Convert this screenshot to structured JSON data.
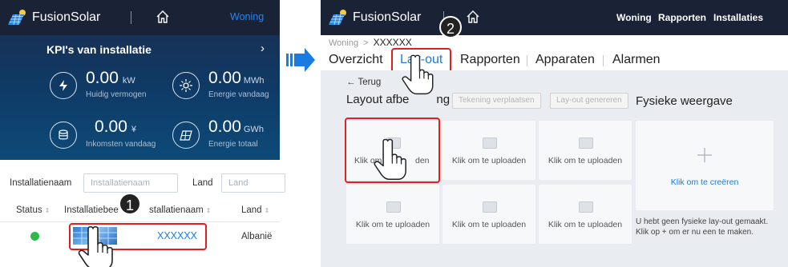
{
  "colors": {
    "accent": "#1a7be0",
    "highlight": "#e02020",
    "online": "#2fb84a"
  },
  "left": {
    "app_title": "FusionSolar",
    "nav_active": "Woning",
    "kpi_title": "KPI's van installatie",
    "kpis": [
      {
        "value": "0.00",
        "unit": "kW",
        "label": "Huidig vermogen"
      },
      {
        "value": "0.00",
        "unit": "MWh",
        "label": "Energie vandaag"
      },
      {
        "value": "0.00",
        "unit": "¥",
        "label": "Inkomsten vandaag"
      },
      {
        "value": "0.00",
        "unit": "GWh",
        "label": "Energie totaal"
      }
    ],
    "filter": {
      "name_label": "Installatienaam",
      "name_placeholder": "Installatienaam",
      "country_label": "Land",
      "country_placeholder": "Land"
    },
    "table": {
      "headers": [
        "Status",
        "Installatiebee",
        "stallatienaam",
        "Land"
      ],
      "row": {
        "name": "XXXXXX",
        "country": "Albanië"
      }
    },
    "step_badge": "1"
  },
  "right": {
    "app_title": "FusionSolar",
    "nav": [
      "Woning",
      "Rapporten",
      "Installaties"
    ],
    "breadcrumb": {
      "root": "Woning",
      "sep": ">",
      "current": "XXXXXX"
    },
    "tabs": [
      "Overzicht",
      "Lay-out",
      "Rapporten",
      "Apparaten",
      "Alarmen"
    ],
    "active_tab": "Lay-out",
    "back": "Terug",
    "section_title": "Layout afbe",
    "section_title_tail": "ng",
    "btn_move": "Tekening verplaatsen",
    "btn_generate": "Lay-out genereren",
    "physical_title": "Fysieke weergave",
    "tile_label": "Klik om te uploaden",
    "tile_label_partial_left": "Klik om te",
    "tile_label_partial_right": "den",
    "create_label": "Klik om te creëren",
    "empty_note_1": "U hebt geen fysieke lay-out gemaakt.",
    "empty_note_2": "Klik op + om er nu een te maken.",
    "step_badge": "2"
  }
}
